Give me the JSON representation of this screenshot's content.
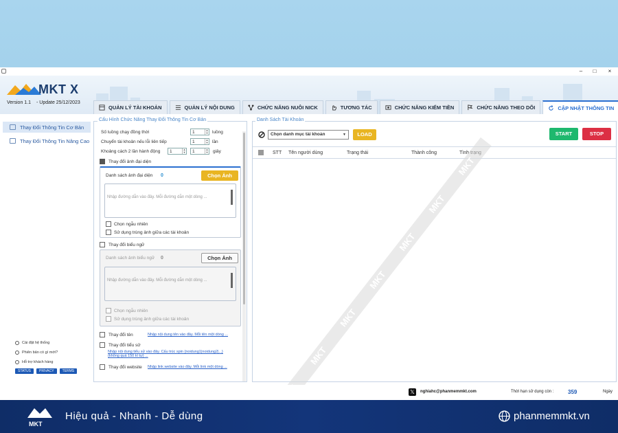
{
  "app": {
    "logo_text": "MKT X",
    "version": "Version  1.1",
    "update": "- Update  25/12/2023",
    "minimize": "–",
    "maximize": "□",
    "close": "×"
  },
  "tabs": [
    {
      "label": "QUẢN LÝ TÀI KHOẢN",
      "icon": "grid-icon",
      "active": false
    },
    {
      "label": "QUẢN LÝ NỘI DUNG",
      "icon": "list-icon",
      "active": false
    },
    {
      "label": "CHỨC NĂNG NUÔI NICK",
      "icon": "nodes-icon",
      "active": false
    },
    {
      "label": "TƯƠNG TÁC",
      "icon": "hand-icon",
      "active": false
    },
    {
      "label": "CHỨC NĂNG KIẾM TIỀN",
      "icon": "money-icon",
      "active": false
    },
    {
      "label": "CHỨC NĂNG THEO DÕI",
      "icon": "flag-icon",
      "active": false
    },
    {
      "label": "CẬP NHẬT THÔNG TIN",
      "icon": "refresh-icon",
      "active": true
    }
  ],
  "sidebar": {
    "items": [
      {
        "label": "Thay Đổi Thông Tin Cơ Bản",
        "active": true
      },
      {
        "label": "Thay Đổi Thông Tin Nâng Cao",
        "active": false
      }
    ],
    "links": [
      {
        "label": "Cài đặt hệ thống",
        "icon": "settings-icon"
      },
      {
        "label": "Phiên bản có gì mới?",
        "icon": "info-icon"
      },
      {
        "label": "Hỗ trợ khách hàng",
        "icon": "support-icon"
      }
    ],
    "buttons": [
      "STATUS",
      "PRIVACY",
      "TERMS"
    ]
  },
  "config": {
    "legend": "Cấu Hình Chức Năng Thay Đổi Thông Tin Cơ Bản",
    "threads_label": "Số luồng chạy đồng thời",
    "threads_value": "1",
    "threads_unit": "luồng",
    "switch_label": "Chuyển tài khoản nếu lỗi liên tiếp",
    "switch_value": "1",
    "switch_unit": "lần",
    "delay_label": "Khoảng cách 2 lần hành động",
    "delay_from": "1",
    "delay_to": "1",
    "delay_unit": "giây",
    "avatar": {
      "checkbox_label": "Thay đổi ảnh đại diện",
      "checked": true,
      "list_label": "Danh sách ảnh đại diện",
      "count": "0",
      "choose_button": "Chọn Ảnh",
      "placeholder": "Nhập đường dẫn vào đây. Mỗi đường dẫn một dòng ...",
      "random_label": "Chọn ngẫu nhiên",
      "dup_label": "Sử dụng trùng ảnh giữa các tài khoản"
    },
    "cover": {
      "checkbox_label": "Thay đổi biểu ngữ",
      "checked": false,
      "list_label": "Danh sách ảnh biểu ngữ",
      "count": "0",
      "choose_button": "Chọn Ảnh",
      "placeholder": "Nhập đường dẫn vào đây. Mỗi đường dẫn một dòng ...",
      "random_label": "Chọn ngẫu nhiên",
      "dup_label": "Sử dụng trùng ảnh giữa các tài khoản"
    },
    "name": {
      "checkbox_label": "Thay đổi tên",
      "link": "Nhập nội dung tên vào đây. Mỗi tên một dòng ..."
    },
    "bio": {
      "checkbox_label": "Thay đổi tiểu sử",
      "link_line1": "Nhập nội dung tiểu sử vào đây. Cấu trúc spin {noidung1|noidung2|...}",
      "link_line2": "(không quá 150 kí tự) ..."
    },
    "website": {
      "checkbox_label": "Thay đổi website",
      "link": "Nhập link website vào đây. Mỗi link một dòng ..."
    }
  },
  "accounts": {
    "legend": "Danh Sách Tài Khoản",
    "select_value": "Chọn danh mục tài khoản",
    "load_button": "LOAD",
    "start_button": "START",
    "stop_button": "STOP",
    "columns": [
      "STT",
      "Tên người dùng",
      "Trạng thái",
      "Thành công",
      "Tình trạng"
    ]
  },
  "status": {
    "email": "nghiahc@phanmemmkt.com",
    "license_label": "Thời hạn sử dụng còn :",
    "days": "359",
    "days_unit": "Ngày"
  },
  "footer": {
    "logo_text": "MKT",
    "slogan": "Hiệu quả - Nhanh - Dễ dùng",
    "website": "phanmemmkt.vn"
  },
  "watermark": {
    "text": "MKT"
  },
  "colors": {
    "accent_blue": "#2a6fd0",
    "gold": "#e9b522",
    "green": "#1eb86e",
    "red": "#dc2f44",
    "footer_navy": "#13357a"
  }
}
